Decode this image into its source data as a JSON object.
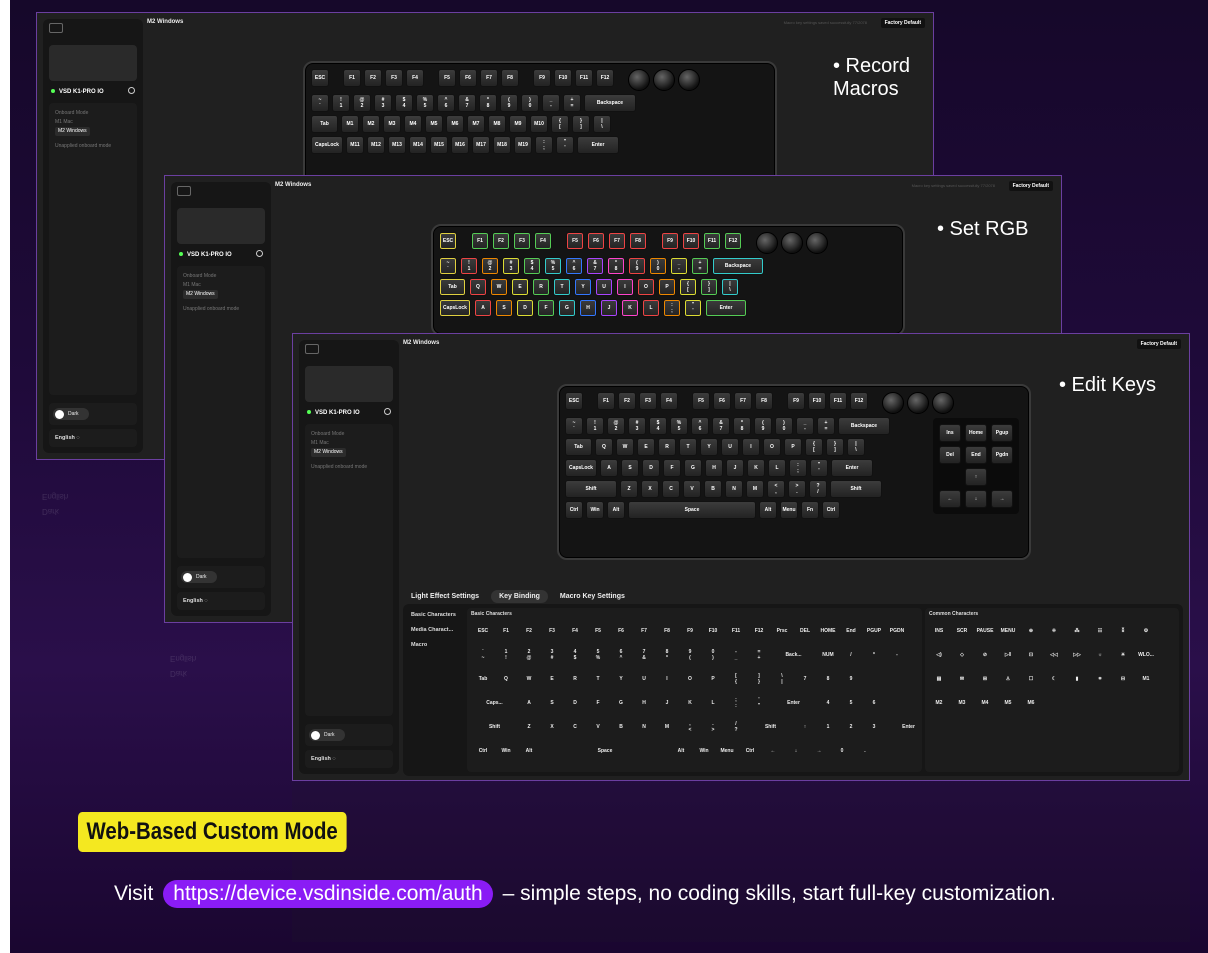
{
  "colors": {
    "background": "#1f0a3a",
    "frame_border": "#6b3fa0",
    "badge_yellow": "#f4e820",
    "url_purple": "#8a1cf5"
  },
  "common": {
    "device_name": "VSD K1-PRO IO",
    "onboard_mode_label": "Onboard Mode",
    "mode_m1": "Mac",
    "mode_m2": "Windows",
    "mode_m1_tag": "M1",
    "mode_m2_tag": "M2",
    "unapplied_label": "Unapplied onboard mode",
    "header_mode_tag": "M2",
    "header_mode": "Windows",
    "factory_default": "Factory Default",
    "status_msg": "Macro key settings saved successfully 77/2078",
    "theme_toggle": "Dark",
    "language": "English"
  },
  "captions": {
    "back": "• Record Macros",
    "middle": "• Set RGB",
    "front": "• Edit Keys"
  },
  "tabs": {
    "light": "Light Effect Settings",
    "binding": "Key Binding",
    "macro": "Macro Key Settings"
  },
  "binding_side": [
    "Basic Characters",
    "Media Charact...",
    "Macro"
  ],
  "binding_titles": {
    "basic": "Basic Characters",
    "common": "Common Characters"
  },
  "keyboard": {
    "fn_row": [
      "ESC",
      "F1",
      "F2",
      "F3",
      "F4",
      "F5",
      "F6",
      "F7",
      "F8",
      "F9",
      "F10",
      "F11",
      "F12"
    ],
    "num_row": [
      "~\n`",
      "!\n1",
      "@\n2",
      "#\n3",
      "$\n4",
      "%\n5",
      "^\n6",
      "&\n7",
      "*\n8",
      "(\n9",
      ")\n0",
      "_\n-",
      "+\n=",
      "Backspace"
    ],
    "tab_row": [
      "Tab",
      "Q",
      "W",
      "E",
      "R",
      "T",
      "Y",
      "U",
      "I",
      "O",
      "P",
      "{\n[",
      "}\n]",
      "|\n\\"
    ],
    "caps_row": [
      "CapsLock",
      "A",
      "S",
      "D",
      "F",
      "G",
      "H",
      "J",
      "K",
      "L",
      ":\n;",
      "\"\n'",
      "Enter"
    ],
    "shift_row": [
      "Shift",
      "Z",
      "X",
      "C",
      "V",
      "B",
      "N",
      "M",
      "<\n,",
      ">\n.",
      "?\n/",
      "Shift"
    ],
    "ctrl_row": [
      "Ctrl",
      "Win",
      "Alt",
      "Space",
      "Alt",
      "Menu",
      "Fn",
      "Ctrl"
    ],
    "nav": [
      "Ins",
      "Home",
      "Pgup",
      "Del",
      "End",
      "Pgdn"
    ],
    "arrows": [
      "↑",
      "←",
      "↓",
      "→"
    ],
    "macro_tab_row": [
      "Tab",
      "M1",
      "M2",
      "M3",
      "M4",
      "M5",
      "M6",
      "M7",
      "M8",
      "M9",
      "M10",
      "{\n[",
      "}\n]",
      "|\n\\"
    ],
    "macro_caps_row": [
      "CapsLock",
      "M11",
      "M12",
      "M13",
      "M14",
      "M15",
      "M16",
      "M17",
      "M18",
      "M19",
      ":\n;",
      "\"\n'",
      "Enter"
    ]
  },
  "binding_grid": {
    "r1": [
      "ESC",
      "F1",
      "F2",
      "F3",
      "F4",
      "F5",
      "F6",
      "F7",
      "F8",
      "F9",
      "F10",
      "F11",
      "F12",
      "Prsc",
      "DEL",
      "HOME",
      "End",
      "PGUP",
      "PGDN"
    ],
    "r2": [
      "`\n~",
      "1\n!",
      "2\n@",
      "3\n#",
      "4\n$",
      "5\n%",
      "6\n^",
      "7\n&",
      "8\n*",
      "9\n(",
      "0\n)",
      "-\n_",
      "=\n+",
      "Back...",
      "NUM",
      "/",
      "*",
      "-"
    ],
    "r3": [
      "Tab",
      "Q",
      "W",
      "E",
      "R",
      "T",
      "Y",
      "U",
      "I",
      "O",
      "P",
      "[\n{",
      "]\n}",
      "\\\n|",
      "7",
      "8",
      "9"
    ],
    "r4": [
      "Caps...",
      "A",
      "S",
      "D",
      "F",
      "G",
      "H",
      "J",
      "K",
      "L",
      ";\n:",
      "'\n\"",
      "Enter",
      "4",
      "5",
      "6"
    ],
    "r5": [
      "Shift",
      "Z",
      "X",
      "C",
      "V",
      "B",
      "N",
      "M",
      ",\n<",
      ".\n>",
      "/\n?",
      "Shift",
      "↑",
      "1",
      "2",
      "3",
      "Enter"
    ],
    "r6": [
      "Ctrl",
      "Win",
      "Alt",
      "Space",
      "Alt",
      "Win",
      "Menu",
      "Ctrl",
      "←",
      "↓",
      "→",
      "0",
      "."
    ],
    "numpad_plus": "+",
    "common_r1": [
      "INS",
      "SCR",
      "PAUSE",
      "MENU"
    ],
    "common_r2": [],
    "common_r3": [],
    "common_r4": [
      "M2",
      "M3",
      "M4",
      "M5",
      "M6"
    ],
    "common_wlo": "WLO...",
    "common_m1": "M1"
  },
  "promo": {
    "badge": "Web-Based Custom Mode",
    "visit": "Visit",
    "url": "https://device.vsdinside.com/auth",
    "tail": "– simple steps, no coding skills, start full-key customization."
  }
}
